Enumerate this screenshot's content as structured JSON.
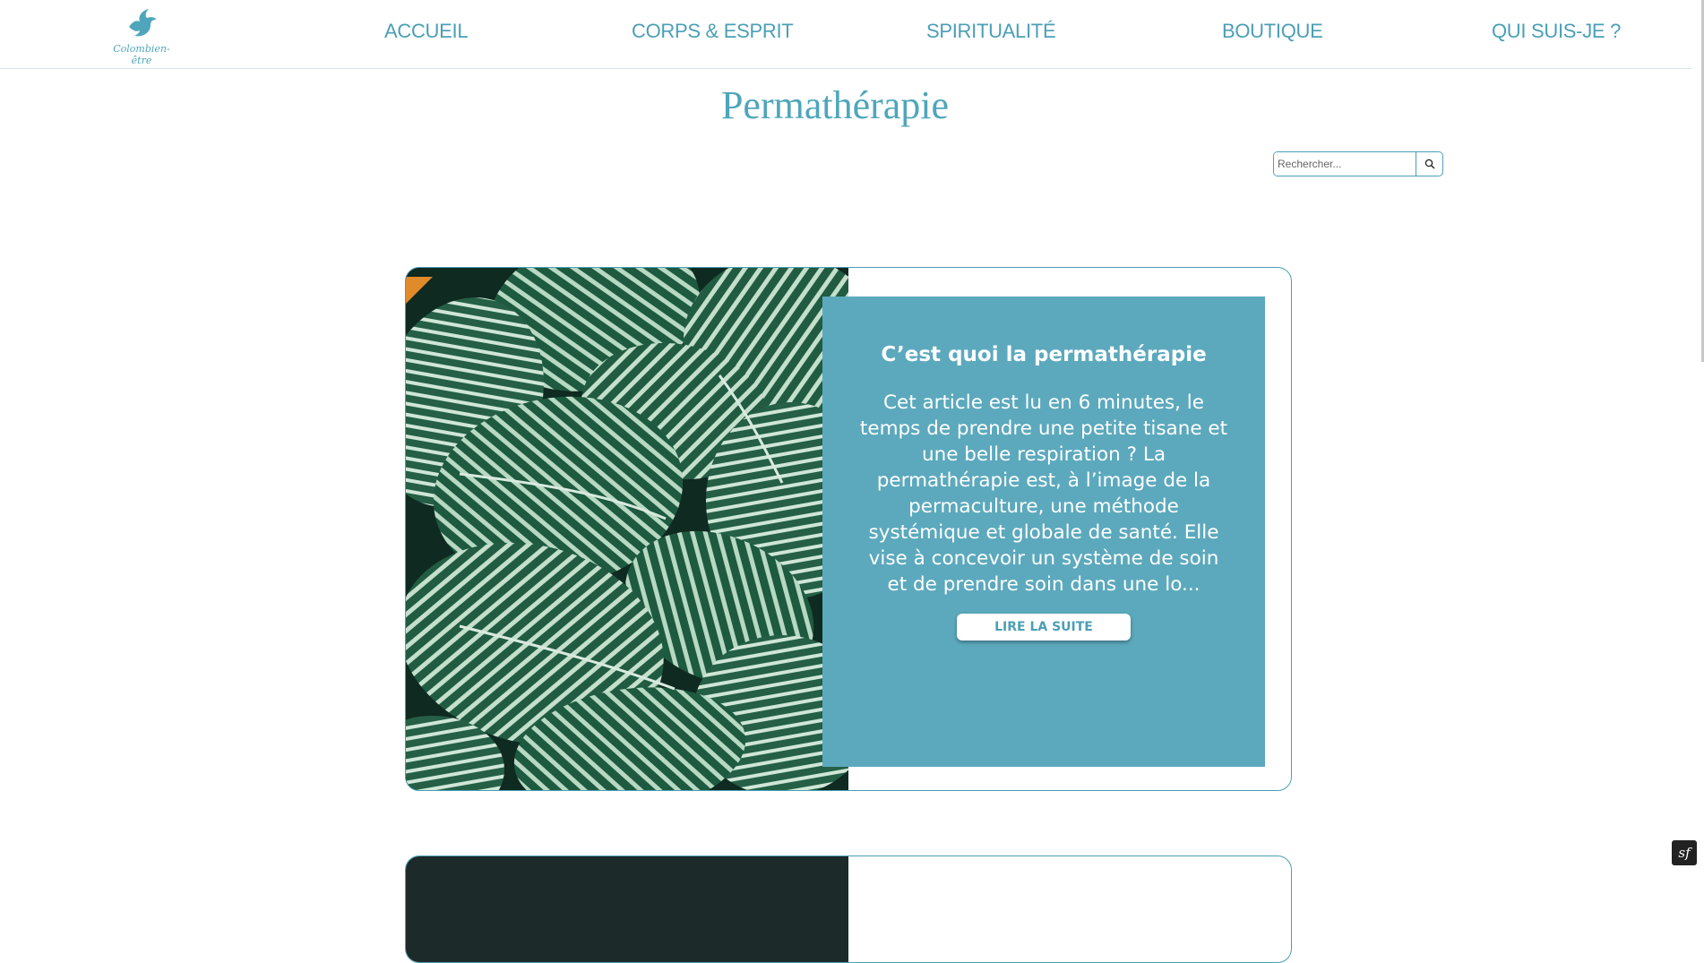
{
  "header": {
    "logo_text": "Colombien-être",
    "nav": [
      {
        "label": "ACCUEIL"
      },
      {
        "label": "CORPS & ESPRIT"
      },
      {
        "label": "SPIRITUALITÉ"
      },
      {
        "label": "BOUTIQUE"
      },
      {
        "label": "QUI SUIS-JE ?"
      }
    ]
  },
  "page": {
    "title": "Permathérapie"
  },
  "search": {
    "placeholder": "Rechercher...",
    "icon": "search-icon"
  },
  "posts": [
    {
      "title": "C’est quoi la permathérapie",
      "excerpt": "Cet article est lu en 6 minutes, le temps de prendre une petite tisane et une belle respiration ? La permathérapie est, à l’image de la permaculture, une méthode systémique et globale de santé. Elle vise à concevoir un système de soin et de prendre soin dans une lo...",
      "read_more": "LIRE LA SUITE",
      "image": "green-striped-leaves"
    }
  ],
  "colors": {
    "accent": "#4b9fb6",
    "panel": "#5ca9bd",
    "leaf_dark": "#1f5a40",
    "leaf_light": "#cfe6d6"
  },
  "badge_text": "sf"
}
